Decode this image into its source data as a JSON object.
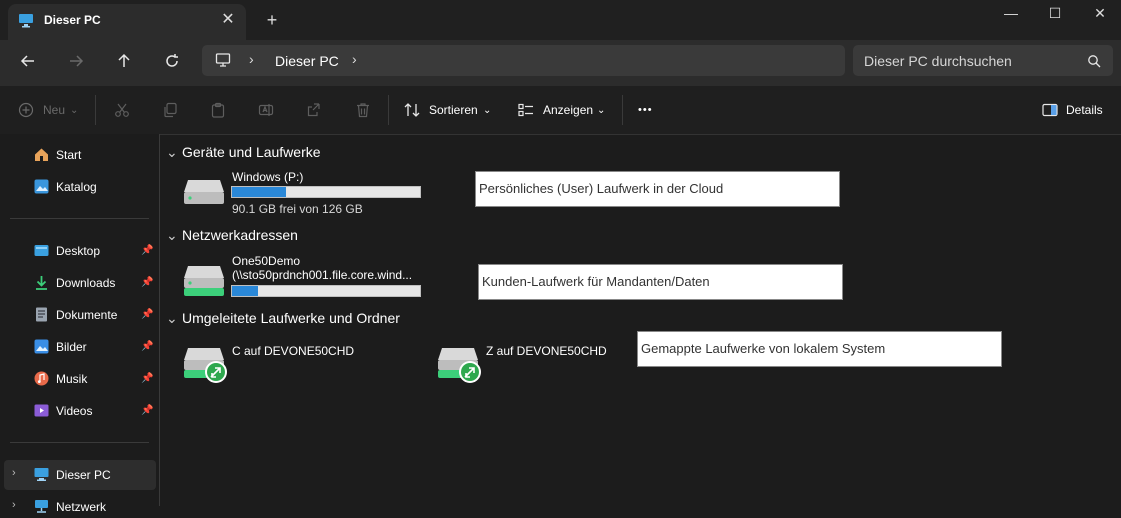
{
  "window": {
    "tab_title": "Dieser PC",
    "tab_close": "✕",
    "new_tab": "+",
    "controls": {
      "minimize": "—",
      "maximize": "☐",
      "close": "✕"
    }
  },
  "navigation": {
    "breadcrumb": [
      "Dieser PC"
    ],
    "separator": "›",
    "search_placeholder": "Dieser PC durchsuchen"
  },
  "toolbar": {
    "new_label": "Neu",
    "sort_label": "Sortieren",
    "view_label": "Anzeigen",
    "more_label": "•••",
    "details_label": "Details"
  },
  "sidebar": {
    "items": [
      {
        "label": "Start",
        "icon": "home-icon",
        "color": "#e8a35a"
      },
      {
        "label": "Katalog",
        "icon": "gallery-icon",
        "color": "#3a96dd"
      },
      {
        "label": "Desktop",
        "icon": "desktop-icon",
        "color": "#3aa0e0",
        "pinned": true
      },
      {
        "label": "Downloads",
        "icon": "download-icon",
        "color": "#3ccf7a",
        "pinned": true
      },
      {
        "label": "Dokumente",
        "icon": "document-icon",
        "color": "#9aa4b0",
        "pinned": true
      },
      {
        "label": "Bilder",
        "icon": "pictures-icon",
        "color": "#3a8ee6",
        "pinned": true
      },
      {
        "label": "Musik",
        "icon": "music-icon",
        "color": "#e86a4a",
        "pinned": true
      },
      {
        "label": "Videos",
        "icon": "videos-icon",
        "color": "#8b5cd6",
        "pinned": true
      },
      {
        "label": "Dieser PC",
        "icon": "pc-icon",
        "color": "#3aa0e0"
      },
      {
        "label": "Netzwerk",
        "icon": "network-icon",
        "color": "#3aa0e0"
      }
    ]
  },
  "sections": {
    "devices": {
      "title": "Geräte und Laufwerke",
      "drive": {
        "name": "Windows (P:)",
        "usage": 0.285,
        "sub": "90.1 GB frei von 126 GB"
      }
    },
    "network": {
      "title": "Netzwerkadressen",
      "drive": {
        "name": "One50Demo",
        "path": "(\\\\sto50prdnch001.file.core.wind...",
        "usage": 0.14
      }
    },
    "redirected": {
      "title": "Umgeleitete Laufwerke und Ordner",
      "drives": [
        {
          "name": "C auf DEVONE50CHD"
        },
        {
          "name": "Z auf DEVONE50CHD"
        }
      ]
    }
  },
  "annotations": {
    "cloud": "Persönliches (User) Laufwerk in der Cloud",
    "customer": "Kunden-Laufwerk für Mandanten/Daten",
    "mapped": "Gemappte Laufwerke von lokalem System"
  }
}
